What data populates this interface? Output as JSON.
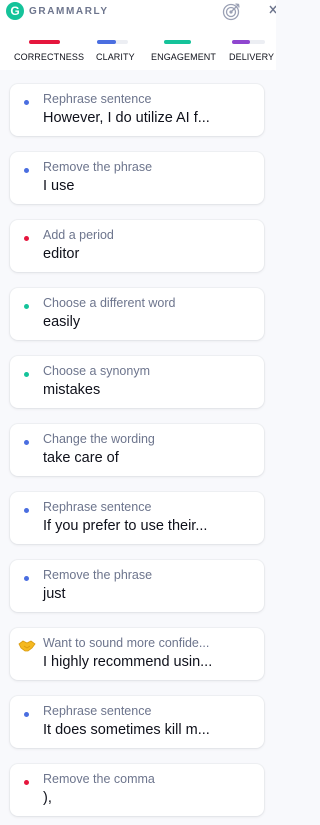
{
  "header": {
    "logo_letter": "G",
    "brand": "GRAMMARLY",
    "goals_icon": "target-icon",
    "close_icon": "close-icon"
  },
  "tabs": [
    {
      "label": "CORRECTNESS",
      "color": "#e5163d",
      "fill": 1.0
    },
    {
      "label": "CLARITY",
      "color": "#4a6ee0",
      "fill": 0.6
    },
    {
      "label": "ENGAGEMENT",
      "color": "#15c39a",
      "fill": 1.0
    },
    {
      "label": "DELIVERY",
      "color": "#8f46cf",
      "fill": 0.55
    }
  ],
  "cards": [
    {
      "category": "clarity",
      "title": "Rephrase sentence",
      "text": "However, I do utilize AI f..."
    },
    {
      "category": "clarity",
      "title": "Remove the phrase",
      "text": "I use"
    },
    {
      "category": "correctness",
      "title": "Add a period",
      "text": "editor"
    },
    {
      "category": "engagement",
      "title": "Choose a different word",
      "text": "easily"
    },
    {
      "category": "engagement",
      "title": "Choose a synonym",
      "text": "mistakes"
    },
    {
      "category": "clarity",
      "title": "Change the wording",
      "text": "take care of"
    },
    {
      "category": "clarity",
      "title": "Rephrase sentence",
      "text": "If you prefer to use their..."
    },
    {
      "category": "clarity",
      "title": "Remove the phrase",
      "text": "just"
    },
    {
      "category": "delivery",
      "icon": "handshake-icon",
      "title": "Want to sound more confide...",
      "text": "I highly recommend usin..."
    },
    {
      "category": "clarity",
      "title": "Rephrase sentence",
      "text": "It does sometimes kill m..."
    },
    {
      "category": "correctness",
      "title": "Remove the comma",
      "text": "),"
    }
  ],
  "colors": {
    "correctness": "#e5163d",
    "clarity": "#4a6ee0",
    "engagement": "#15c39a",
    "delivery": "#8f46cf"
  }
}
